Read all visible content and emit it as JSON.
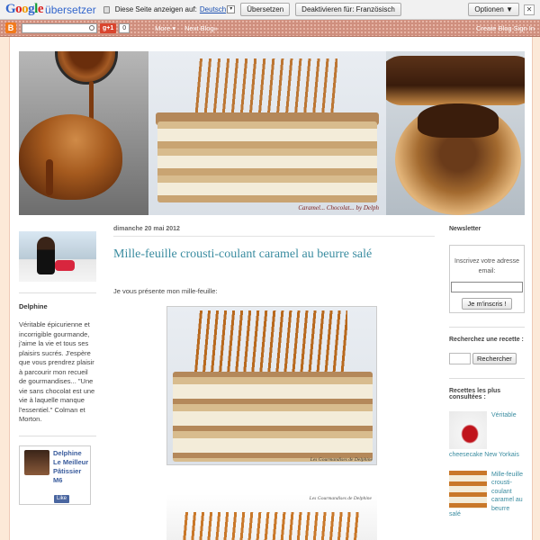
{
  "translate_bar": {
    "logo_google": "Google",
    "logo_service": "übersetzer",
    "prompt": "Diese Seite anzeigen auf:",
    "language": "Deutsch",
    "translate_button": "Übersetzen",
    "disable_button": "Deaktivieren für: Französisch",
    "options_button": "Optionen ▼",
    "close": "✕"
  },
  "navbar": {
    "logo": "B",
    "g1": "g+1",
    "count": "0",
    "more": "More ▾",
    "next_blog": "Next Blog»",
    "create_blog": "Create Blog  Sign In"
  },
  "banner": {
    "signature": "Caramel... Chocolat...      by Delph"
  },
  "left_sidebar": {
    "author_heading": "Delphine",
    "bio": "Véritable épicurienne et incorrigible gourmande, j'aime la vie et tous ses plaisirs sucrés. J'espère que vous prendrez plaisir à parcourir mon recueil de gourmandises... \"Une vie sans chocolat est une vie à laquelle manque l'essentiel.\" Colman et Morton.",
    "profile_name": "Delphine Le Meilleur Pâtissier M6",
    "like": "Like"
  },
  "post": {
    "date": "dimanche 20 mai 2012",
    "title": "Mille-feuille crousti-coulant caramel au beurre salé",
    "intro": "Je vous présente mon mille-feuille:",
    "image1_caption": "Les Gourmandises de Delphine",
    "image2_caption": "Les Gourmandises de Delphine"
  },
  "right_sidebar": {
    "newsletter_heading": "Newsletter",
    "newsletter_text": "Inscrivez votre adresse email:",
    "subscribe_button": "Je m'inscris !",
    "search_heading": "Recherchez une recette :",
    "search_button": "Rechercher",
    "popular_heading": "Recettes les plus consultées :",
    "popular": [
      {
        "side": "Véritable",
        "below": "cheesecake New Yorkais"
      },
      {
        "side": "Mille-feuille crousti-coulant caramel au beurre",
        "below": "salé"
      }
    ]
  }
}
